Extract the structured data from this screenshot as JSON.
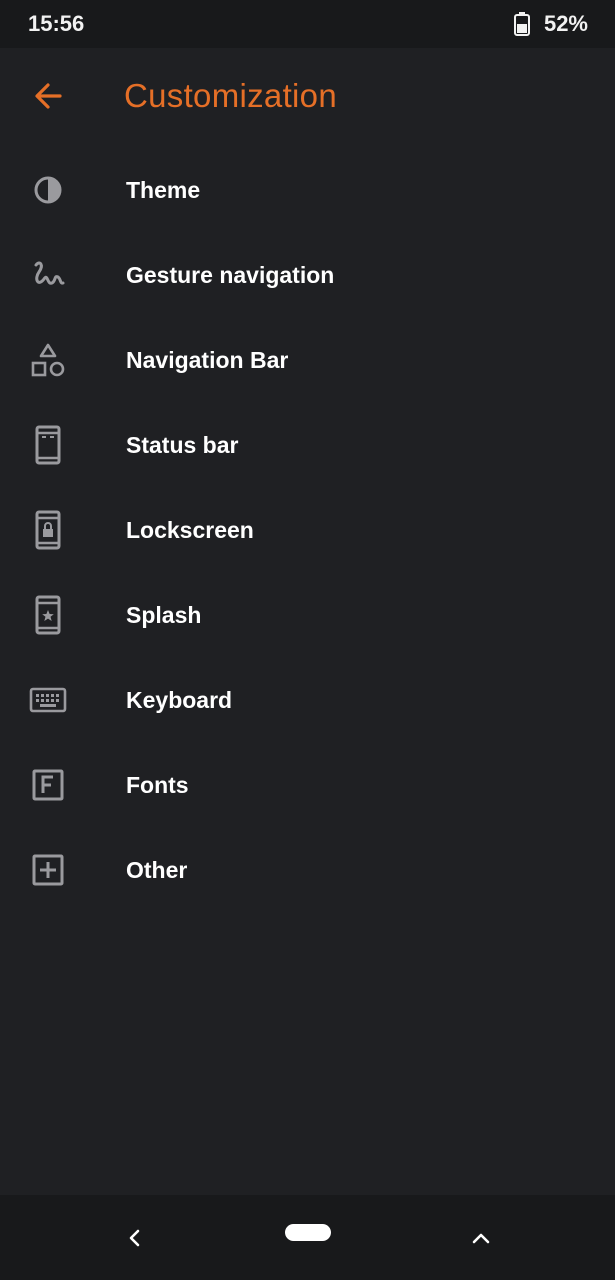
{
  "status_bar": {
    "time": "15:56",
    "battery_percent": "52%",
    "battery_icon": "battery-icon"
  },
  "app_bar": {
    "title": "Customization",
    "back_icon": "arrow-left-icon",
    "accent_color": "#e56f27"
  },
  "menu": {
    "items": [
      {
        "label": "Theme",
        "icon": "theme-icon"
      },
      {
        "label": "Gesture navigation",
        "icon": "gesture-icon"
      },
      {
        "label": "Navigation Bar",
        "icon": "shapes-icon"
      },
      {
        "label": "Status bar",
        "icon": "phone-status-icon"
      },
      {
        "label": "Lockscreen",
        "icon": "phone-lock-icon"
      },
      {
        "label": "Splash",
        "icon": "phone-star-icon"
      },
      {
        "label": "Keyboard",
        "icon": "keyboard-icon"
      },
      {
        "label": "Fonts",
        "icon": "font-icon"
      },
      {
        "label": "Other",
        "icon": "plus-box-icon"
      }
    ]
  },
  "nav_bar": {
    "back_icon": "chevron-left-icon",
    "home_icon": "home-pill-icon",
    "up_icon": "chevron-up-icon"
  }
}
